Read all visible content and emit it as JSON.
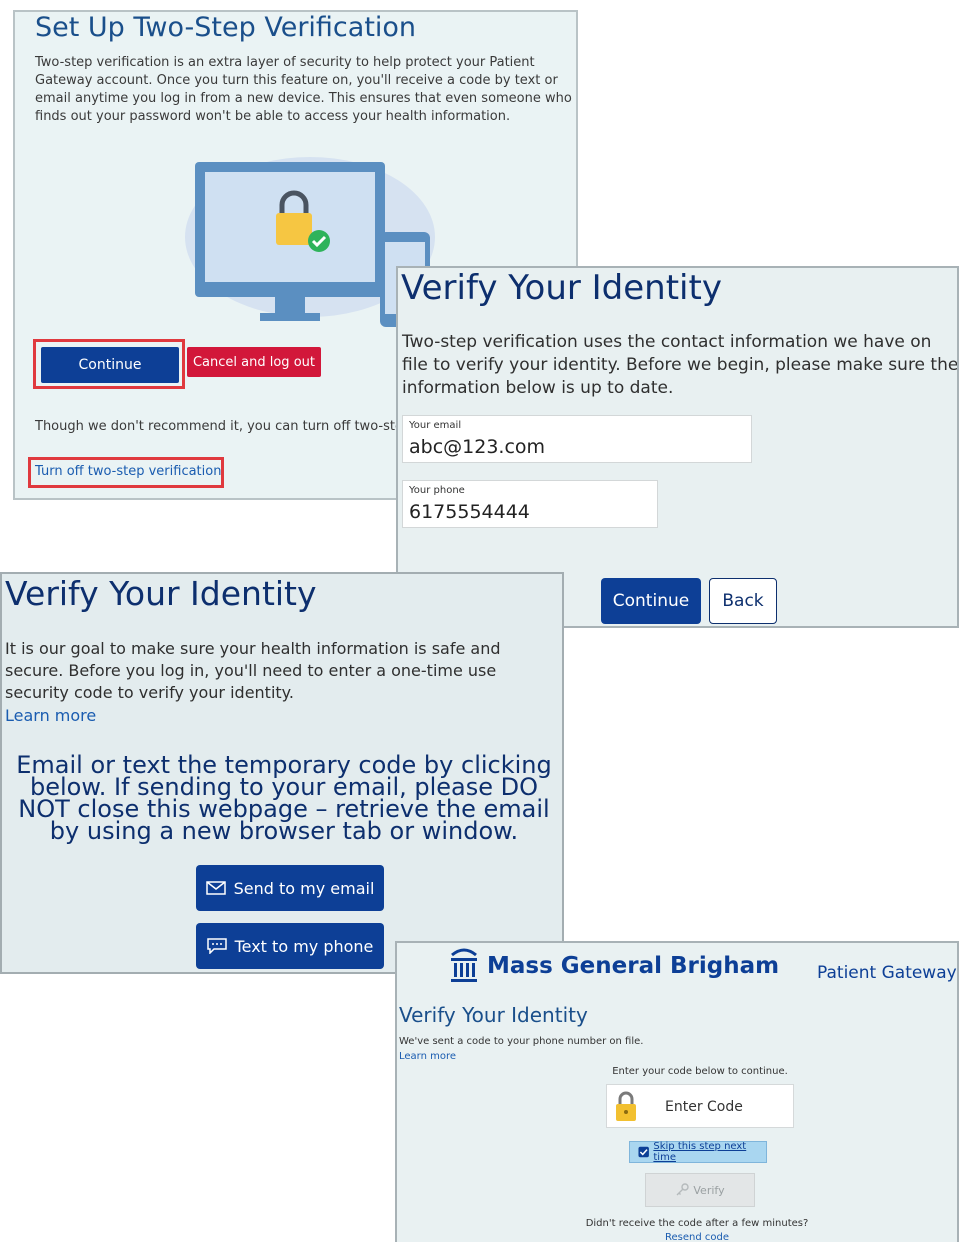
{
  "setup": {
    "title": "Set Up Two-Step Verification",
    "description": "Two-step verification is an extra layer of security to help protect your Patient Gateway account. Once you turn this feature on, you'll receive a code by text or email anytime you log in from a new device. This ensures that even someone who finds out your password won't be able to access your health information.",
    "continue_label": "Continue",
    "cancel_label": "Cancel and log out",
    "warning": "Though we don't recommend it, you can turn off two-step verification below.",
    "turn_off_link": "Turn off two-step verification"
  },
  "verify_contact": {
    "title": "Verify Your Identity",
    "description": "Two-step verification uses the contact information we have on file to verify your identity. Before we begin, please make sure the information below is up to date.",
    "email_label": "Your email",
    "email_value": "abc@123.com",
    "phone_label": "Your phone",
    "phone_value": "6175554444",
    "continue_label": "Continue",
    "back_label": "Back"
  },
  "verify_send": {
    "title": "Verify Your Identity",
    "description": "It is our goal to make sure your health information is safe and secure. Before you log in, you'll need to enter a one-time use security code to verify your identity.",
    "learn_more": "Learn more",
    "instructions": "Email or text the temporary code by clicking below. If sending to your email, please DO NOT close this webpage – retrieve the email by using a new browser tab or window.",
    "email_button": "Send to my email",
    "text_button": "Text to my phone"
  },
  "verify_code": {
    "brand": "Mass General Brigham",
    "portal": "Patient Gateway",
    "title": "Verify Your Identity",
    "sent_message": "We've sent a code to your phone number on file.",
    "learn_more": "Learn more",
    "enter_label": "Enter your code below to continue.",
    "code_placeholder": "Enter Code",
    "skip_label": "Skip this step next time",
    "verify_label": "Verify",
    "didnt_receive": "Didn't receive the code after a few minutes?",
    "resend": "Resend code"
  },
  "colors": {
    "primary": "#0d3f96",
    "cancel": "#d2173a",
    "highlight": "#e0393e",
    "link": "#1a5cb0"
  }
}
